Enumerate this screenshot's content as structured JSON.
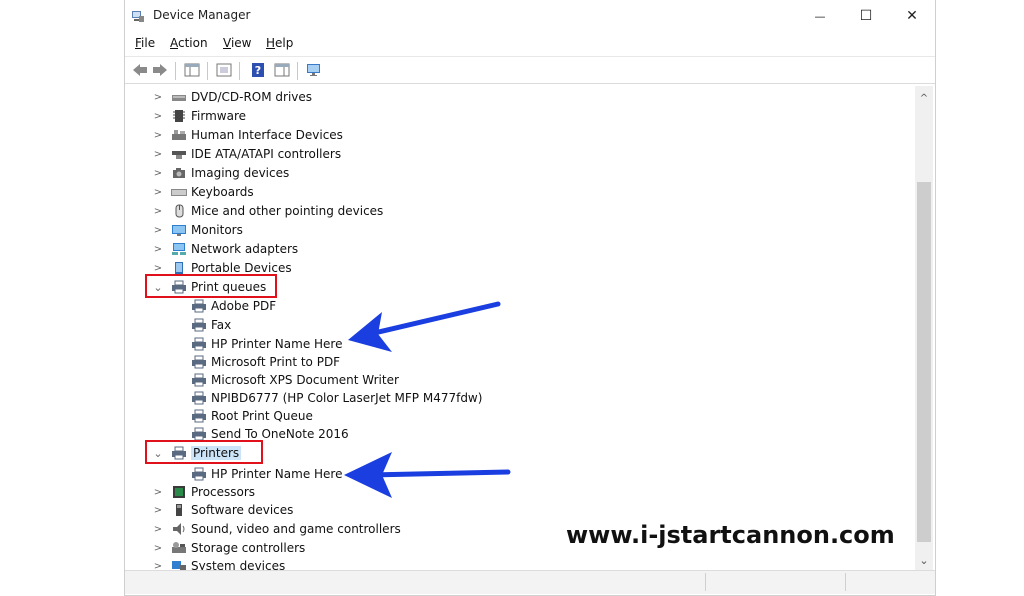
{
  "window": {
    "title": "Device Manager",
    "controls": {
      "minimize": "—",
      "maximize": "☐",
      "close": "✕"
    }
  },
  "menu": [
    {
      "label": "File",
      "key": "F",
      "rest": "ile"
    },
    {
      "label": "Action",
      "key": "A",
      "rest": "ction"
    },
    {
      "label": "View",
      "key": "V",
      "rest": "iew"
    },
    {
      "label": "Help",
      "key": "H",
      "rest": "elp"
    }
  ],
  "tree": {
    "categories_top": [
      {
        "label": "DVD/CD-ROM drives",
        "icon": "dvd-drive-icon"
      },
      {
        "label": "Firmware",
        "icon": "firmware-icon"
      },
      {
        "label": "Human Interface Devices",
        "icon": "hid-icon"
      },
      {
        "label": "IDE ATA/ATAPI controllers",
        "icon": "ide-controller-icon"
      },
      {
        "label": "Imaging devices",
        "icon": "camera-icon"
      },
      {
        "label": "Keyboards",
        "icon": "keyboard-icon"
      },
      {
        "label": "Mice and other pointing devices",
        "icon": "mouse-icon"
      },
      {
        "label": "Monitors",
        "icon": "monitor-icon"
      },
      {
        "label": "Network adapters",
        "icon": "network-adapter-icon"
      },
      {
        "label": "Portable Devices",
        "icon": "portable-device-icon"
      }
    ],
    "print_queues": {
      "label": "Print queues",
      "children": [
        "Adobe PDF",
        "Fax",
        "HP Printer Name Here",
        "Microsoft Print to PDF",
        "Microsoft XPS Document Writer",
        "NPIBD6777 (HP Color LaserJet MFP M477fdw)",
        "Root Print Queue",
        "Send To OneNote 2016"
      ]
    },
    "printers": {
      "label": "Printers",
      "children": [
        "HP Printer Name Here"
      ]
    },
    "categories_bottom": [
      {
        "label": "Processors",
        "icon": "processor-icon"
      },
      {
        "label": "Software devices",
        "icon": "software-device-icon"
      },
      {
        "label": "Sound, video and game controllers",
        "icon": "sound-icon"
      },
      {
        "label": "Storage controllers",
        "icon": "storage-controller-icon"
      },
      {
        "label": "System devices",
        "icon": "system-device-icon"
      }
    ]
  },
  "watermark": "www.i-jstartcannon.com",
  "colors": {
    "highlight_box": "#e0111b",
    "arrow": "#1a3ee0"
  }
}
